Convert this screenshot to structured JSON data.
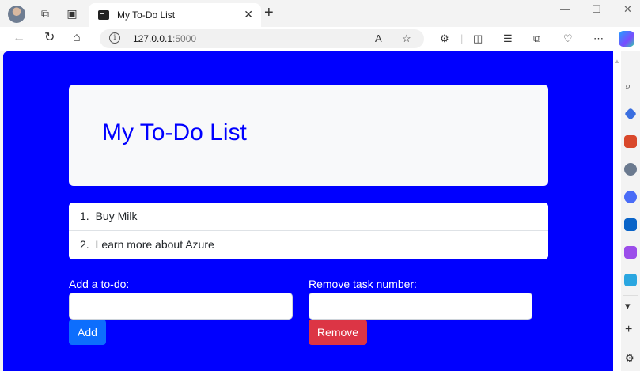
{
  "browser": {
    "tab_title": "My To-Do List",
    "url_host": "127.0.0.1",
    "url_port": ":5000"
  },
  "page": {
    "title": "My To-Do List",
    "todos": [
      {
        "number": "1.",
        "text": "Buy Milk"
      },
      {
        "number": "2.",
        "text": "Learn more about Azure"
      }
    ],
    "add_label": "Add a to-do:",
    "add_input_value": "",
    "add_button": "Add",
    "remove_label": "Remove task number:",
    "remove_input_value": "",
    "remove_button": "Remove"
  },
  "colors": {
    "page_background": "#0000ff",
    "title_color": "#0000ff",
    "add_button": "#0d6efd",
    "remove_button": "#dc3545"
  }
}
